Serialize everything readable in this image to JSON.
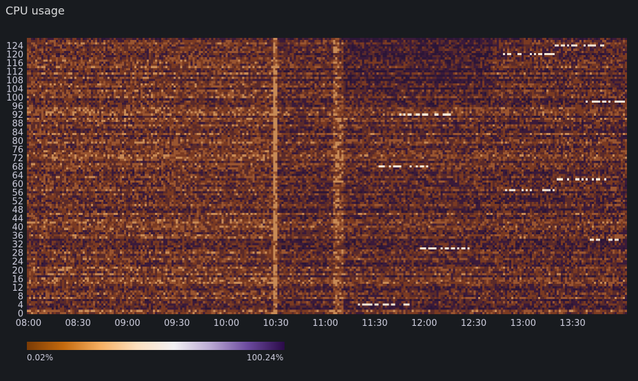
{
  "panel": {
    "title": "CPU usage"
  },
  "chart_data": {
    "type": "heatmap",
    "title": "CPU usage",
    "x_axis": {
      "ticks": [
        "08:00",
        "08:30",
        "09:00",
        "09:30",
        "10:00",
        "10:30",
        "11:00",
        "11:30",
        "12:00",
        "12:30",
        "13:00",
        "13:30"
      ],
      "range": [
        "07:59",
        "14:03"
      ]
    },
    "y_axis": {
      "ticks": [
        "0",
        "4",
        "8",
        "12",
        "16",
        "20",
        "24",
        "28",
        "32",
        "36",
        "40",
        "44",
        "48",
        "52",
        "56",
        "60",
        "64",
        "68",
        "72",
        "76",
        "80",
        "84",
        "88",
        "92",
        "96",
        "100",
        "104",
        "108",
        "112",
        "116",
        "120",
        "124"
      ],
      "range": [
        0,
        127
      ]
    },
    "color_scale": {
      "min_label": "0.02%",
      "max_label": "100.24%",
      "min": 0.02,
      "max": 100.24,
      "stops": [
        "#7a3b05",
        "#c46a0e",
        "#f6b063",
        "#fbe0c0",
        "#f2f0f3",
        "#b9a8d3",
        "#6b4a9e",
        "#2a0a48"
      ]
    },
    "cell_palette": [
      "#2b1537",
      "#3a1a3a",
      "#5a2a2a",
      "#7a3a22",
      "#9a5530",
      "#c88a55",
      "#f2e6d6"
    ],
    "grid": false
  }
}
